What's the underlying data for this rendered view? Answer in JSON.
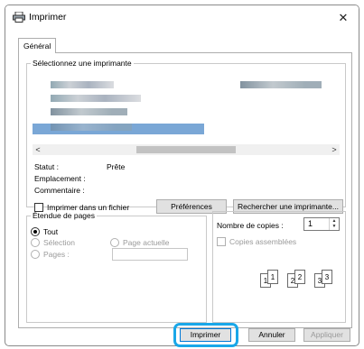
{
  "window": {
    "title": "Imprimer",
    "close_glyph": "✕"
  },
  "tabs": [
    {
      "label": "Général"
    }
  ],
  "printer_group": {
    "legend": "Sélectionnez une imprimante",
    "scroll_left": "<",
    "scroll_right": ">",
    "status_label": "Statut :",
    "status_value": "Prête",
    "location_label": "Emplacement :",
    "comment_label": "Commentaire :",
    "print_to_file_label": "Imprimer dans un fichier",
    "preferences_label": "Préférences",
    "search_label": "Rechercher une imprimante..."
  },
  "range_group": {
    "legend": "Étendue de pages",
    "all_label": "Tout",
    "selection_label": "Sélection",
    "current_page_label": "Page actuelle",
    "pages_label": "Pages :"
  },
  "copies_group": {
    "copies_label": "Nombre de copies :",
    "copies_value": "1",
    "collate_label": "Copies assemblées",
    "collate_pages": [
      "1",
      "1",
      "2",
      "2",
      "3",
      "3"
    ]
  },
  "footer": {
    "print_label": "Imprimer",
    "cancel_label": "Annuler",
    "apply_label": "Appliquer"
  },
  "colors": {
    "accent": "#0078d7",
    "highlight": "#1aa7e8",
    "selected_row": "#7aa7d6"
  }
}
